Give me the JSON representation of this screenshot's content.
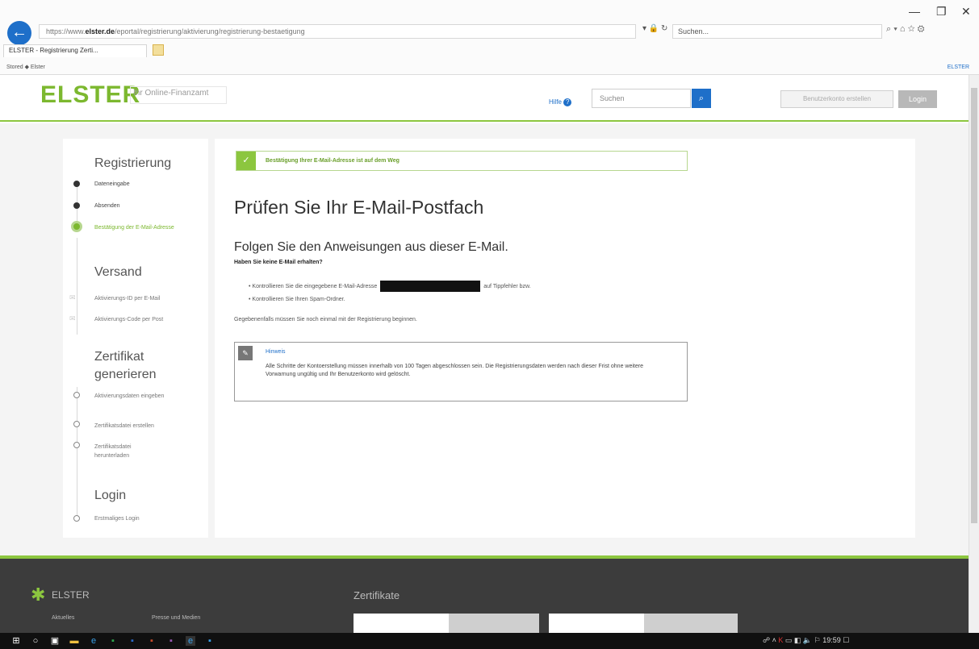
{
  "browser": {
    "address_prefix": "https://www.",
    "address_domain": "elster.de",
    "address_rest": "/eportal/registrierung/aktivierung/registrierung-bestaetigung",
    "search_placeholder": "Suchen...",
    "tab_title": "ELSTER - Registrierung Zerti...",
    "fav_items": "Stored  ◆  Elster",
    "fav_right": "ELSTER"
  },
  "header": {
    "logo": "ELSTER",
    "logo_sub": "Ihr Online-Finanzamt",
    "help_label": "Hilfe",
    "search_placeholder": "Suchen",
    "register_label": "Benutzerkonto erstellen",
    "login_label": "Login"
  },
  "sidebar": {
    "section1": "Registrierung",
    "item_dateneingabe": "Dateneingabe",
    "item_absenden": "Absenden",
    "item_bestaetigung": "Bestätigung der E-Mail-Adresse",
    "section2": "Versand",
    "item_aktivierungs_id": "Aktivierungs-ID per E-Mail",
    "item_aktivierungs_code": "Aktivierungs-Code per Post",
    "section3": "Zertifikat generieren",
    "item_aktivierungsdaten": "Aktivierungsdaten eingeben",
    "item_zertifikatsdatei_erstellen": "Zertifikatsdatei erstellen",
    "item_zertifikatsdatei_herunterladen": "Zertifikatsdatei herunterladen",
    "section4": "Login",
    "item_erstmaliges_login": "Erstmaliges Login"
  },
  "content": {
    "success_message": "Bestätigung Ihrer E-Mail-Adresse ist auf dem Weg",
    "title": "Prüfen Sie Ihr E-Mail-Postfach",
    "subtitle": "Folgen Sie den Anweisungen aus dieser E-Mail.",
    "question": "Haben Sie keine E-Mail erhalten?",
    "bullet1_before": "• Kontrollieren Sie die eingegebene E-Mail-Adresse",
    "bullet1_after": "auf Tippfehler bzw.",
    "bullet2": "• Kontrollieren Sie Ihren Spam-Ordner.",
    "note_paragraph": "Gegebenenfalls müssen Sie noch einmal mit der Registrierung beginnen.",
    "hint_title": "Hinweis",
    "hint_body": "Alle Schritte der Kontoerstellung müssen innerhalb von 100 Tagen abgeschlossen sein. Die Registrierungsdaten werden nach dieser Frist ohne weitere Vorwarnung ungültig und Ihr Benutzerkonto wird gelöscht."
  },
  "footer": {
    "brand": "ELSTER",
    "link1": "Aktuelles",
    "link2": "Presse und Medien",
    "heading": "Zertifikate"
  },
  "taskbar": {
    "time": "19:59"
  },
  "colors": {
    "brand_green": "#7cb82f",
    "accent_blue": "#1e6fc9",
    "footer_bg": "#3c3c3c"
  }
}
